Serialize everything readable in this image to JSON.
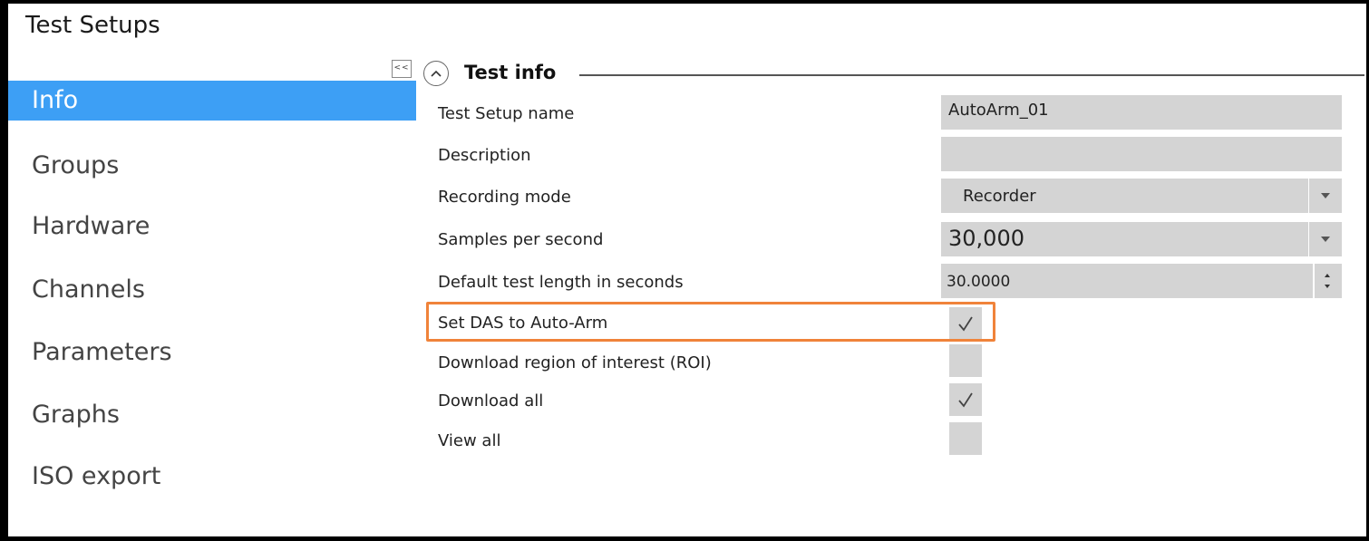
{
  "app": {
    "title": "Test Setups"
  },
  "sidebar": {
    "collapse_label": "<<",
    "items": [
      {
        "label": "Info",
        "active": true
      },
      {
        "label": "Groups"
      },
      {
        "label": "Hardware"
      },
      {
        "label": "Channels"
      },
      {
        "label": "Parameters"
      },
      {
        "label": "Graphs"
      },
      {
        "label": "ISO export"
      }
    ]
  },
  "section": {
    "title": "Test info",
    "toggle_icon": "chevron-up-icon"
  },
  "form": {
    "test_setup_name": {
      "label": "Test Setup name",
      "value": "AutoArm_01"
    },
    "description": {
      "label": "Description",
      "value": ""
    },
    "recording_mode": {
      "label": "Recording mode",
      "value": "Recorder"
    },
    "samples_per_second": {
      "label": "Samples per second",
      "value": "30,000"
    },
    "default_test_length": {
      "label": "Default test length in seconds",
      "value": "30.0000"
    },
    "set_das_auto_arm": {
      "label": "Set DAS to Auto-Arm",
      "checked": true
    },
    "download_roi": {
      "label": "Download region of interest (ROI)",
      "checked": false
    },
    "download_all": {
      "label": "Download all",
      "checked": true
    },
    "view_all": {
      "label": "View all",
      "checked": false
    }
  },
  "colors": {
    "accent": "#3d9ff5",
    "highlight": "#f0833a",
    "field_bg": "#d4d4d4"
  }
}
